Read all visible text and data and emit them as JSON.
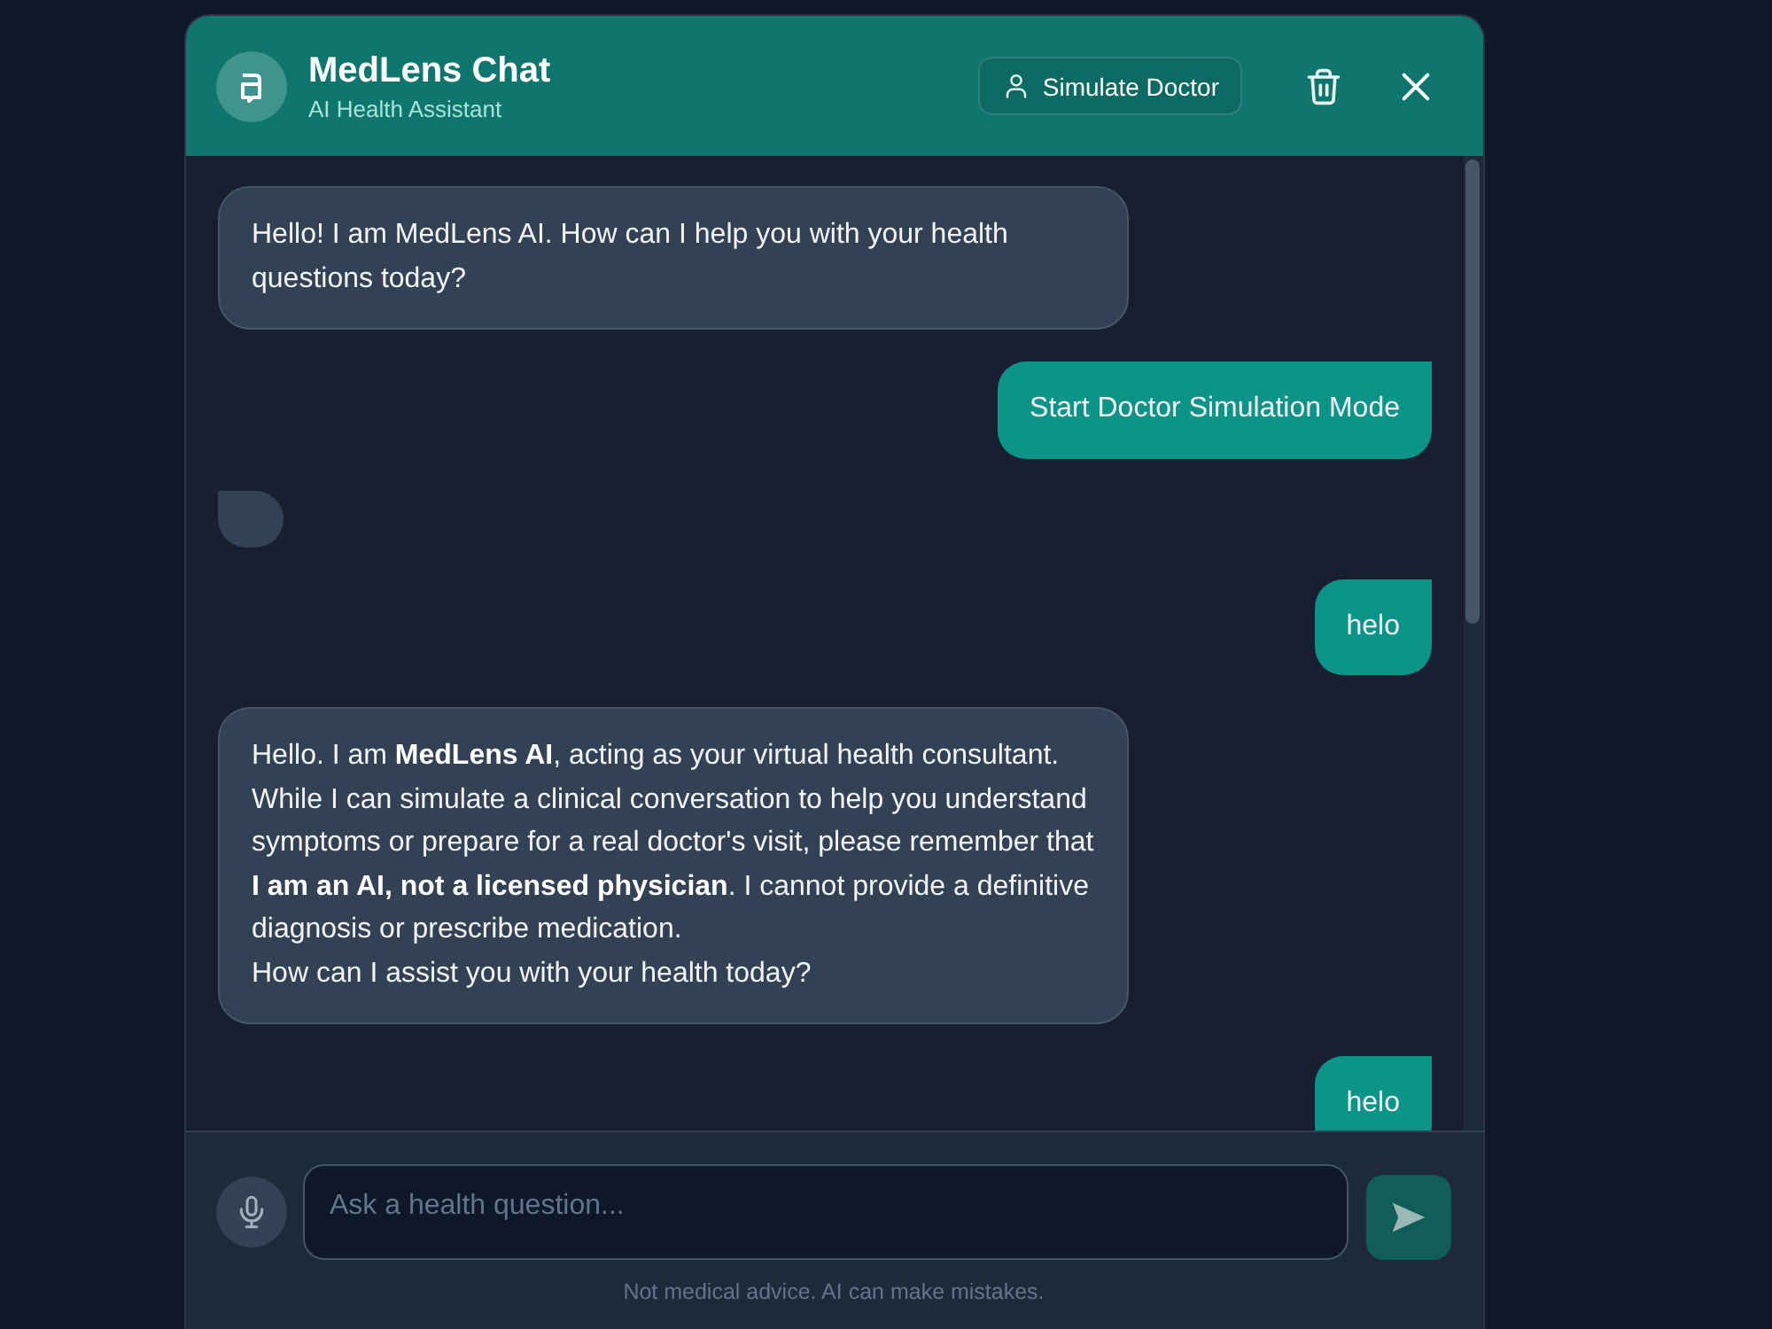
{
  "header": {
    "title": "MedLens Chat",
    "subtitle": "AI Health Assistant",
    "mode_button": {
      "label": "Simulate Doctor"
    }
  },
  "messages": [
    {
      "kind": "bot",
      "text": "Hello! I am MedLens AI. How can I help you with your health questions today?"
    },
    {
      "kind": "user",
      "text": "Start Doctor Simulation Mode"
    },
    {
      "kind": "bot"
    },
    {
      "kind": "user",
      "text": "helo"
    },
    {
      "kind": "bot",
      "text": "Hello. I am **MedLens AI**, acting as your virtual health consultant. While I can simulate a clinical conversation to help you understand symptoms or prepare for a real doctor's visit, please remember that **I am an AI, not a licensed physician**. I cannot provide a definitive diagnosis or prescribe medication.\nHow can I assist you with your health today?"
    },
    {
      "kind": "user",
      "text": "helo"
    }
  ],
  "composer": {
    "placeholder": "Ask a health question...",
    "send_button": {
      "disabled": true
    }
  },
  "disclaimer": "Not medical advice. AI can make mistakes."
}
